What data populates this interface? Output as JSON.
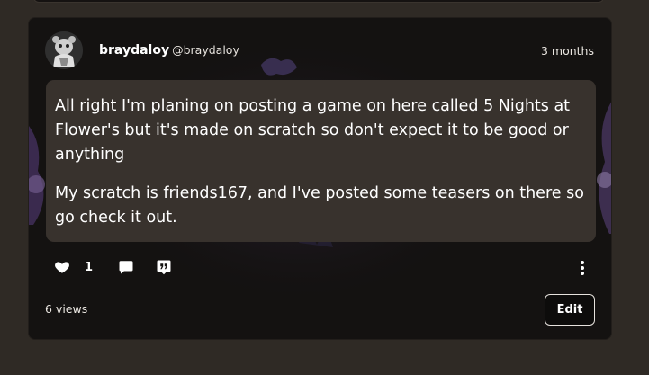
{
  "post": {
    "author_name": "braydaloy",
    "author_handle": "@braydaloy",
    "timestamp": "3 months",
    "paragraphs": [
      "All right I'm planing on posting a game on here called 5 Nights at Flower's but it's made on scratch so don't expect it to be good or anything",
      "My scratch is friends167, and I've posted some teasers on there so go check it out."
    ],
    "likes": "1",
    "views": "6 views",
    "edit_label": "Edit"
  },
  "icons": {
    "like": "heart-icon",
    "comment": "comment-icon",
    "quote": "quote-icon",
    "more": "more-vertical-icon"
  },
  "colors": {
    "page_bg": "#2f2a25",
    "card_bg": "#141211",
    "bubble_bg": "#38322d",
    "text": "#ffffff"
  }
}
